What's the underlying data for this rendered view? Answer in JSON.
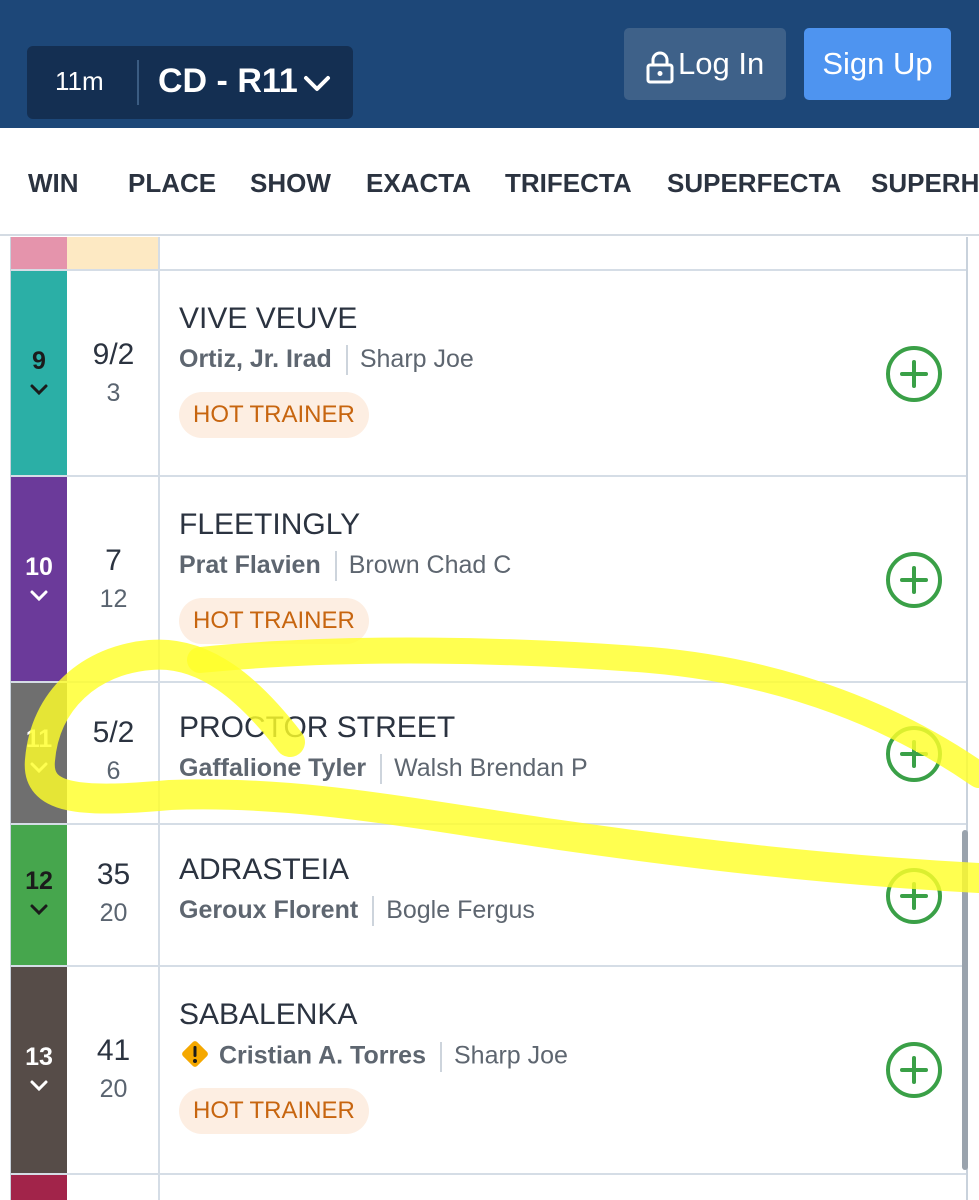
{
  "header": {
    "race_time": "11m",
    "race_name": "CD - R11",
    "login_label": "Log In",
    "signup_label": "Sign Up"
  },
  "tabs": [
    "WIN",
    "PLACE",
    "SHOW",
    "EXACTA",
    "TRIFECTA",
    "SUPERFECTA",
    "SUPERHI"
  ],
  "runners": [
    {
      "number": "9",
      "color": "#2bafa6",
      "odds": "9/2",
      "live": "3",
      "horse": "VIVE VEUVE",
      "jockey": "Ortiz, Jr. Irad",
      "trainer": "Sharp Joe",
      "badge": "HOT TRAINER",
      "warning": false
    },
    {
      "number": "10",
      "color": "#6b3a9a",
      "odds": "7",
      "live": "12",
      "horse": "FLEETINGLY",
      "jockey": "Prat Flavien",
      "trainer": "Brown Chad C",
      "badge": "HOT TRAINER",
      "warning": false
    },
    {
      "number": "11",
      "color": "#6f6f6f",
      "odds": "5/2",
      "live": "6",
      "horse": "PROCTOR STREET",
      "jockey": "Gaffalione Tyler",
      "trainer": "Walsh Brendan P",
      "badge": "",
      "warning": false
    },
    {
      "number": "12",
      "color": "#46a64d",
      "odds": "35",
      "live": "20",
      "horse": "ADRASTEIA",
      "jockey": "Geroux Florent",
      "trainer": "Bogle Fergus",
      "badge": "",
      "warning": false
    },
    {
      "number": "13",
      "color": "#564c48",
      "odds": "41",
      "live": "20",
      "horse": "SABALENKA",
      "jockey": "Cristian A. Torres",
      "trainer": "Sharp Joe",
      "badge": "HOT TRAINER",
      "warning": true
    }
  ],
  "colors": {
    "header_bg": "#1d4778",
    "add_icon": "#3aa047",
    "badge_text": "#c7650f",
    "highlight": "#ffff2a"
  },
  "icons": {
    "lock": "lock-icon",
    "chevron": "chevron-down-icon",
    "add": "plus-circle-icon",
    "warning": "warning-icon"
  }
}
